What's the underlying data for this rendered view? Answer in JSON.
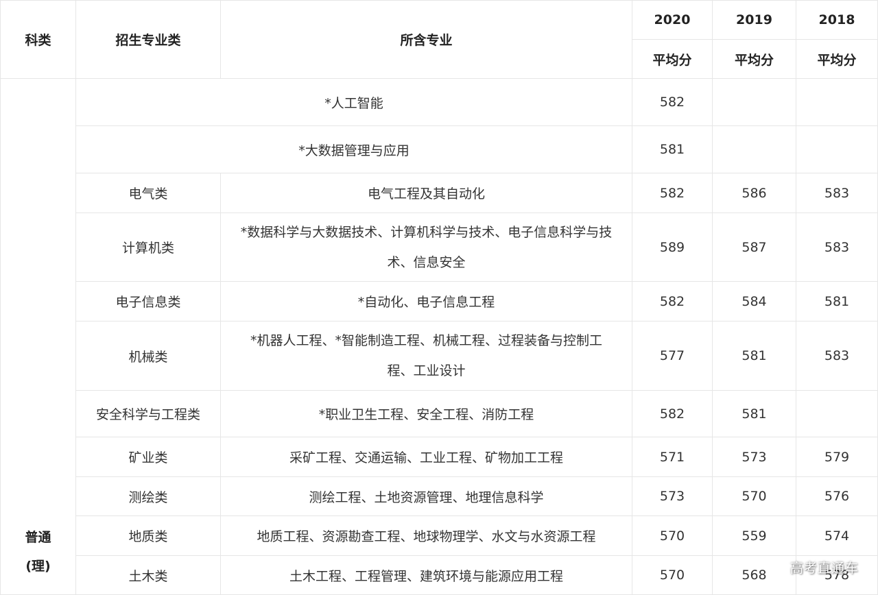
{
  "header": {
    "category": "科类",
    "major_class": "招生专业类",
    "majors": "所含专业",
    "years": [
      "2020",
      "2019",
      "2018"
    ],
    "avg_label": "平均分"
  },
  "category_value": "普通\n(理)",
  "category_line1": "普通",
  "category_line2": "(理)",
  "rows": [
    {
      "major_class": "",
      "majors": "*人工智能",
      "y2020": "582",
      "y2019": "",
      "y2018": ""
    },
    {
      "major_class": "",
      "majors": "*大数据管理与应用",
      "y2020": "581",
      "y2019": "",
      "y2018": ""
    },
    {
      "major_class": "电气类",
      "majors": "电气工程及其自动化",
      "y2020": "582",
      "y2019": "586",
      "y2018": "583"
    },
    {
      "major_class": "计算机类",
      "majors": "*数据科学与大数据技术、计算机科学与技术、电子信息科学与技术、信息安全",
      "y2020": "589",
      "y2019": "587",
      "y2018": "583"
    },
    {
      "major_class": "电子信息类",
      "majors": "*自动化、电子信息工程",
      "y2020": "582",
      "y2019": "584",
      "y2018": "581"
    },
    {
      "major_class": "机械类",
      "majors": "*机器人工程、*智能制造工程、机械工程、过程装备与控制工程、工业设计",
      "y2020": "577",
      "y2019": "581",
      "y2018": "583"
    },
    {
      "major_class": "安全科学与工程类",
      "majors": "*职业卫生工程、安全工程、消防工程",
      "y2020": "582",
      "y2019": "581",
      "y2018": ""
    },
    {
      "major_class": "矿业类",
      "majors": "采矿工程、交通运输、工业工程、矿物加工工程",
      "y2020": "571",
      "y2019": "573",
      "y2018": "579"
    },
    {
      "major_class": "测绘类",
      "majors": "测绘工程、土地资源管理、地理信息科学",
      "y2020": "573",
      "y2019": "570",
      "y2018": "576"
    },
    {
      "major_class": "地质类",
      "majors": "地质工程、资源勘查工程、地球物理学、水文与水资源工程",
      "y2020": "570",
      "y2019": "559",
      "y2018": "574"
    },
    {
      "major_class": "土木类",
      "majors": "土木工程、工程管理、建筑环境与能源应用工程",
      "y2020": "570",
      "y2019": "568",
      "y2018": "578"
    }
  ],
  "watermark": "高考直通车"
}
